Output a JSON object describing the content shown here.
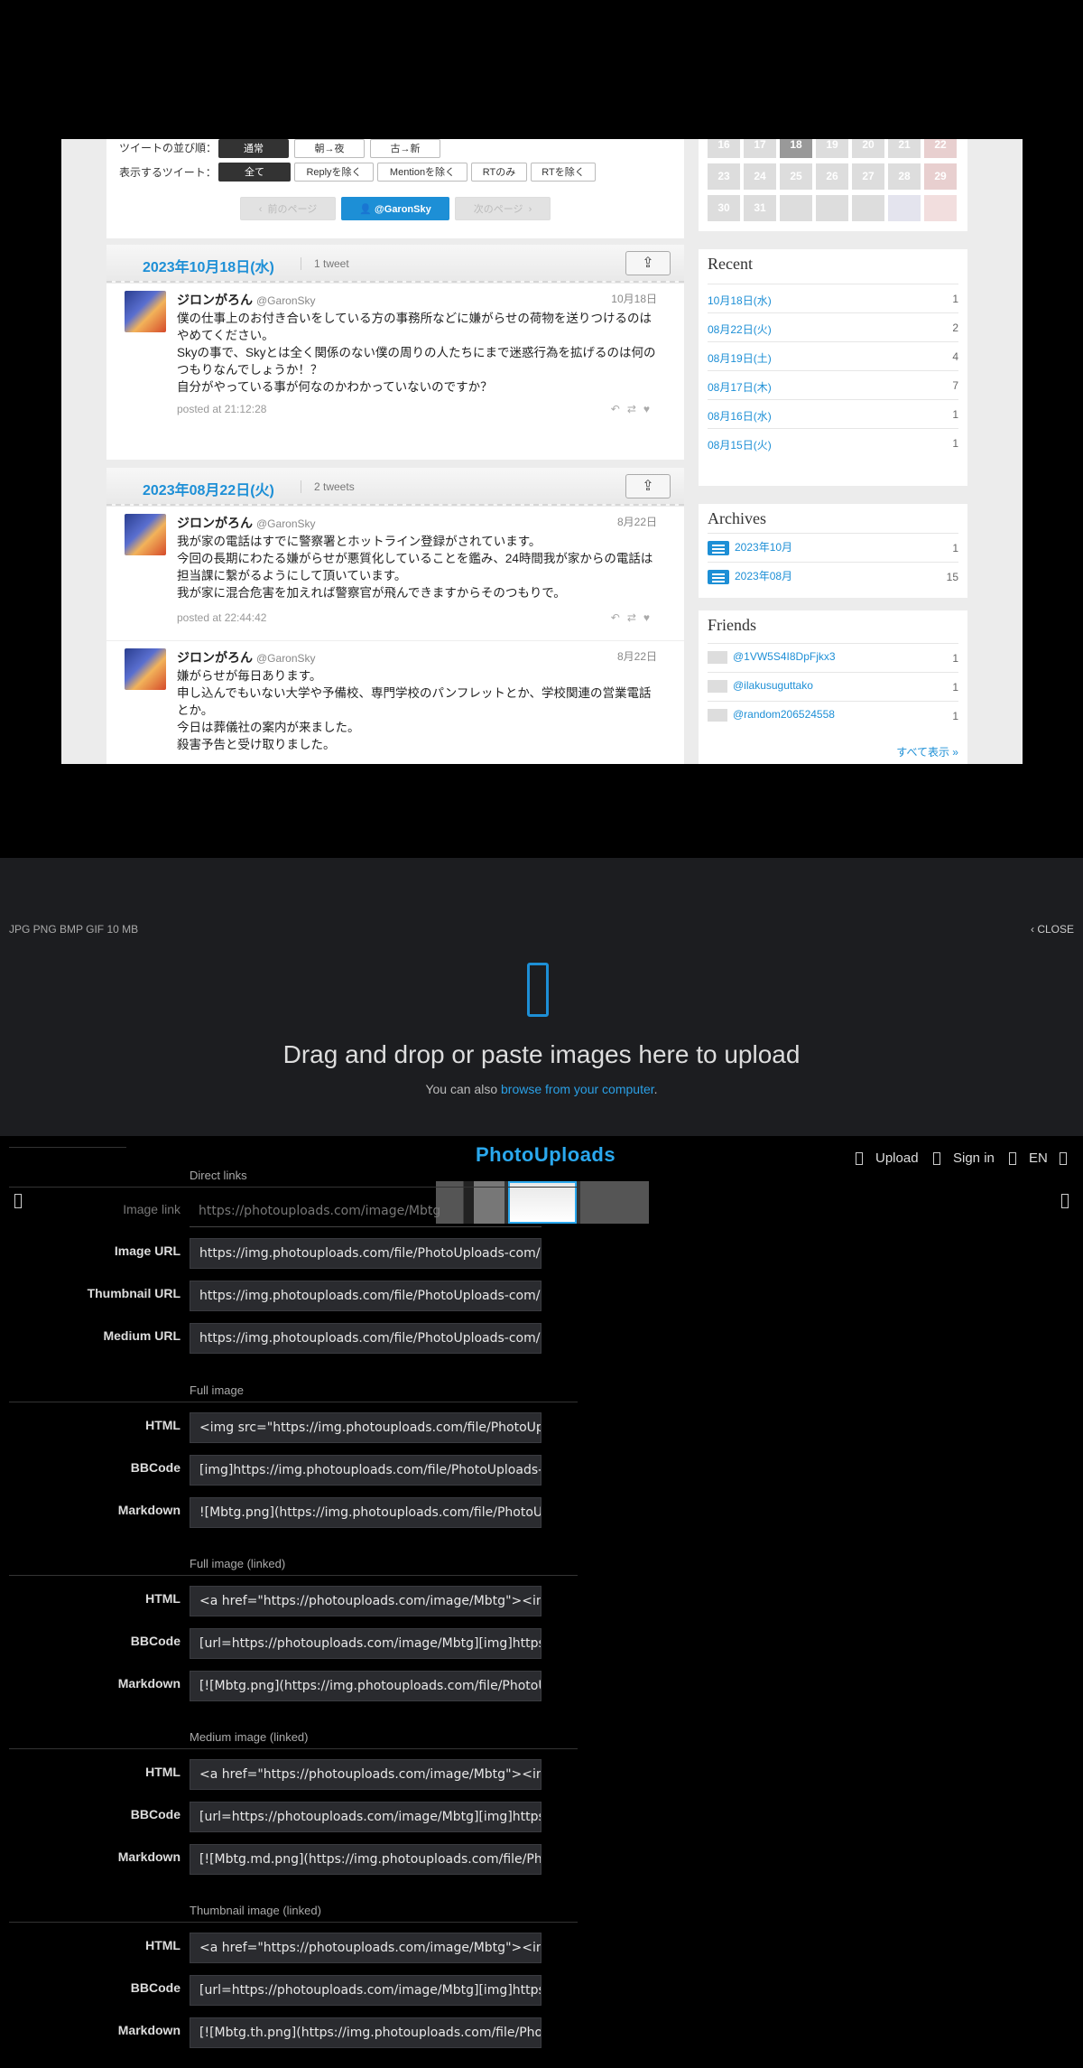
{
  "shot": {
    "sort_label": "ツイートの並び順：",
    "sort_options": [
      "通常",
      "朝→夜",
      "古→新"
    ],
    "filter_label": "表示するツイート：",
    "filter_options": [
      "全て",
      "Replyを除く",
      "Mentionを除く",
      "RTのみ",
      "RTを除く"
    ],
    "prev_page": "前のページ",
    "next_page": "次のページ",
    "user_button": "@GaronSky",
    "days": [
      {
        "date": "2023年10月18日(水)",
        "count": "1 tweet"
      },
      {
        "date": "2023年08月22日(火)",
        "count": "2 tweets"
      }
    ],
    "tweets": [
      {
        "name": "ジロンがろん",
        "handle": "@GaronSky",
        "date": "10月18日",
        "body": "僕の仕事上のお付き合いをしている方の事務所などに嫌がらせの荷物を送りつけるのはやめてください。\nSkyの事で、Skyとは全く関係のない僕の周りの人たちにまで迷惑行為を拡げるのは何のつもりなんでしょうか！？\n自分がやっている事が何なのかわかっていないのですか？",
        "posted": "posted at 21:12:28"
      },
      {
        "name": "ジロンがろん",
        "handle": "@GaronSky",
        "date": "8月22日",
        "body": "我が家の電話はすでに警察署とホットライン登録がされています。\n今回の長期にわたる嫌がらせが悪質化していることを鑑み、24時間我が家からの電話は担当課に繋がるようにして頂いています。\n我が家に混合危害を加えれば警察官が飛んできますからそのつもりで。",
        "posted": "posted at 22:44:42"
      },
      {
        "name": "ジロンがろん",
        "handle": "@GaronSky",
        "date": "8月22日",
        "body": "嫌がらせが毎日あります。\n申し込んでもいない大学や予備校、専門学校のパンフレットとか、学校関連の営業電話とか。\n今日は葬儀社の案内が来ました。\n殺害予告と受け取りました。",
        "posted": ""
      }
    ],
    "calendar": {
      "row1": [
        "16",
        "17",
        "18",
        "19",
        "20",
        "21",
        "22"
      ],
      "row2": [
        "23",
        "24",
        "25",
        "26",
        "27",
        "28",
        "29"
      ],
      "row3": [
        "30",
        "31",
        "",
        "",
        "",
        "",
        ""
      ]
    },
    "recent_title": "Recent",
    "recent": [
      {
        "label": "10月18日(水)",
        "count": "1"
      },
      {
        "label": "08月22日(火)",
        "count": "2"
      },
      {
        "label": "08月19日(土)",
        "count": "4"
      },
      {
        "label": "08月17日(木)",
        "count": "7"
      },
      {
        "label": "08月16日(水)",
        "count": "1"
      },
      {
        "label": "08月15日(火)",
        "count": "1"
      }
    ],
    "archives_title": "Archives",
    "archives": [
      {
        "label": "2023年10月",
        "count": "1"
      },
      {
        "label": "2023年08月",
        "count": "15"
      }
    ],
    "friends_title": "Friends",
    "friends": [
      {
        "label": "@1VW5S4I8DpFjkx3",
        "count": "1"
      },
      {
        "label": "@ilakusuguttako",
        "count": "1"
      },
      {
        "label": "@random206524558",
        "count": "1"
      }
    ],
    "friends_more": "すべて表示 »"
  },
  "upload": {
    "formats": "JPG PNG BMP GIF   10 MB",
    "close": "CLOSE",
    "title": "Drag and drop or paste images here to upload",
    "sub_prefix": "You can also ",
    "sub_link": "browse from your computer",
    "sub_suffix": "."
  },
  "topbar": {
    "logo": "PhotoUploads",
    "upload": "Upload",
    "signin": "Sign in",
    "lang": "EN"
  },
  "links": {
    "direct_title": "Direct links",
    "image_link_label": "Image link",
    "image_link_value": "https://photouploads.com/image/Mbtg",
    "image_url_label": "Image URL",
    "image_url_value": "https://img.photouploads.com/file/PhotoUploads-com/Mbtg.png",
    "thumb_url_label": "Thumbnail URL",
    "thumb_url_value": "https://img.photouploads.com/file/PhotoUploads-com/Mbtg.th.png",
    "medium_url_label": "Medium URL",
    "medium_url_value": "https://img.photouploads.com/file/PhotoUploads-com/Mbtg.md.png",
    "full_title": "Full image",
    "full_html": "<img src=\"https://img.photouploads.com/file/PhotoUploads-com/Mbtg.png\" alt=\"Mbtg.png\" border=\"0\">",
    "full_bbcode": "[img]https://img.photouploads.com/file/PhotoUploads-com/Mbtg.png[/img]",
    "full_markdown": "![Mbtg.png](https://img.photouploads.com/file/PhotoUploads-com/Mbtg.png)",
    "fulllinked_title": "Full image (linked)",
    "fulllinked_html": "<a href=\"https://photouploads.com/image/Mbtg\"><img src=\"https://img.photouploads.com/file/PhotoUploads-com/Mbtg.png\"></a>",
    "fulllinked_bbcode": "[url=https://photouploads.com/image/Mbtg][img]https://img.photouploads.com/file/PhotoUploads-com/Mbtg.png[/img][/url]",
    "fulllinked_markdown": "[![Mbtg.png](https://img.photouploads.com/file/PhotoUploads-com/Mbtg.png)](https://photouploads.com/image/Mbtg)",
    "medium_title": "Medium image (linked)",
    "medium_html": "<a href=\"https://photouploads.com/image/Mbtg\"><img src=\"https://img.photouploads.com/file/PhotoUploads-com/Mbtg.md.png\"></a>",
    "medium_bbcode": "[url=https://photouploads.com/image/Mbtg][img]https://img.photouploads.com/file/PhotoUploads-com/Mbtg.md.png[/img][/url]",
    "medium_markdown": "[![Mbtg.md.png](https://img.photouploads.com/file/PhotoUploads-com/Mbtg.md.png)](https://photouploads.com/image/Mbtg)",
    "thumb_title": "Thumbnail image (linked)",
    "thumb_html": "<a href=\"https://photouploads.com/image/Mbtg\"><img src=\"https://img.photouploads.com/file/PhotoUploads-com/Mbtg.th.png\"></a>",
    "thumb_bbcode": "[url=https://photouploads.com/image/Mbtg][img]https://img.photouploads.com/file/PhotoUploads-com/Mbtg.th.png[/img][/url]",
    "thumb_markdown": "[![Mbtg.th.png](https://img.photouploads.com/file/PhotoUploads-com/Mbtg.th.png)](https://photouploads.com/image/Mbtg)",
    "html_label": "HTML",
    "bbcode_label": "BBCode",
    "markdown_label": "Markdown"
  },
  "colors": {
    "accent": "#1d8fd6",
    "logo": "#2aa8ee",
    "bg_dark": "#1c1d20"
  }
}
